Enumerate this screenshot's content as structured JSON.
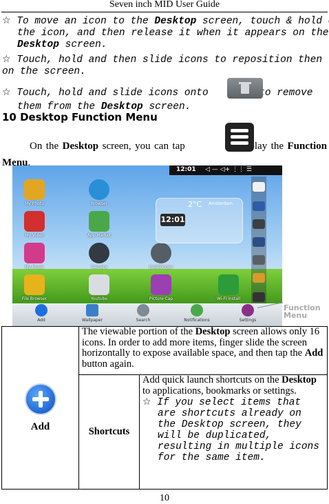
{
  "header": {
    "title": "Seven inch MID User Guide"
  },
  "bullets": [
    {
      "pre": " To move an icon to the ",
      "bold": "Desktop",
      "post": " screen, touch & hold on the icon, and then release it when it appears on the ",
      "bold2": "Desktop",
      "post2": " screen."
    },
    {
      "text": " Touch, hold and then slide icons to reposition then on the screen."
    },
    {
      "pre": " Touch, hold and slide icons onto ",
      "post": " to remove them from the ",
      "bold": "Desktop",
      "post2": " screen."
    }
  ],
  "star_glyph": "☆",
  "section": {
    "heading": "10 Desktop Function Menu"
  },
  "intro": {
    "pre": "On the ",
    "bold": "Desktop",
    "mid": " screen, you can tap ",
    "post": " to display the ",
    "bold2": "Function Menu",
    "end": "."
  },
  "screenshot": {
    "status_time": "12:01",
    "weather_temp": "2°C",
    "weather_city": "Amsterdam",
    "clock": "12:01",
    "apps": [
      {
        "label": "My Photo",
        "color": "#e2a623"
      },
      {
        "label": "Browser",
        "color": "#2a8fd6"
      },
      {
        "label": "My Video",
        "color": "#d22f2f"
      },
      {
        "label": "App Market",
        "color": "#4aa84b"
      },
      {
        "label": "My Music",
        "color": "#d43a8a"
      },
      {
        "label": "Camera",
        "color": "#333a44"
      },
      {
        "label": "Instellingen",
        "color": "#555d66"
      },
      {
        "label": "File Browser",
        "color": "#e7b31d"
      },
      {
        "label": "Youtube",
        "color": "#d9dde2"
      },
      {
        "label": "Picture Cap",
        "color": "#9b3fb3"
      },
      {
        "label": "Wi-Fi install",
        "color": "#2d9b3a"
      }
    ],
    "dock": [
      {
        "label": "Add",
        "color": "#1d6fe0"
      },
      {
        "label": "Wallpaper",
        "color": "#3b7fc8"
      },
      {
        "label": "Search",
        "color": "#7c8b96"
      },
      {
        "label": "Notifications",
        "color": "#4aa84b"
      },
      {
        "label": "Settings",
        "color": "#8a2f86"
      }
    ],
    "callout": "Function Menu"
  },
  "table": {
    "add_label": "Add",
    "add_desc_pre": "The viewable portion of the ",
    "add_desc_bold": "Desktop",
    "add_desc_mid": " screen allows only 16 icons. In order to add more items, finger slide the screen horizontally to expose available space, and then tap the ",
    "add_desc_bold2": "Add",
    "add_desc_end": " button again.",
    "shortcuts_label": "Shortcuts",
    "shortcuts_pre": "Add quick launch shortcuts on the ",
    "shortcuts_bold": "Desktop",
    "shortcuts_post": " to applications, bookmarks or settings.",
    "shortcuts_note": " If you select items that are shortcuts already on the Desktop screen, they will be duplicated, resulting in multiple icons for the same item."
  },
  "page_number": "10"
}
